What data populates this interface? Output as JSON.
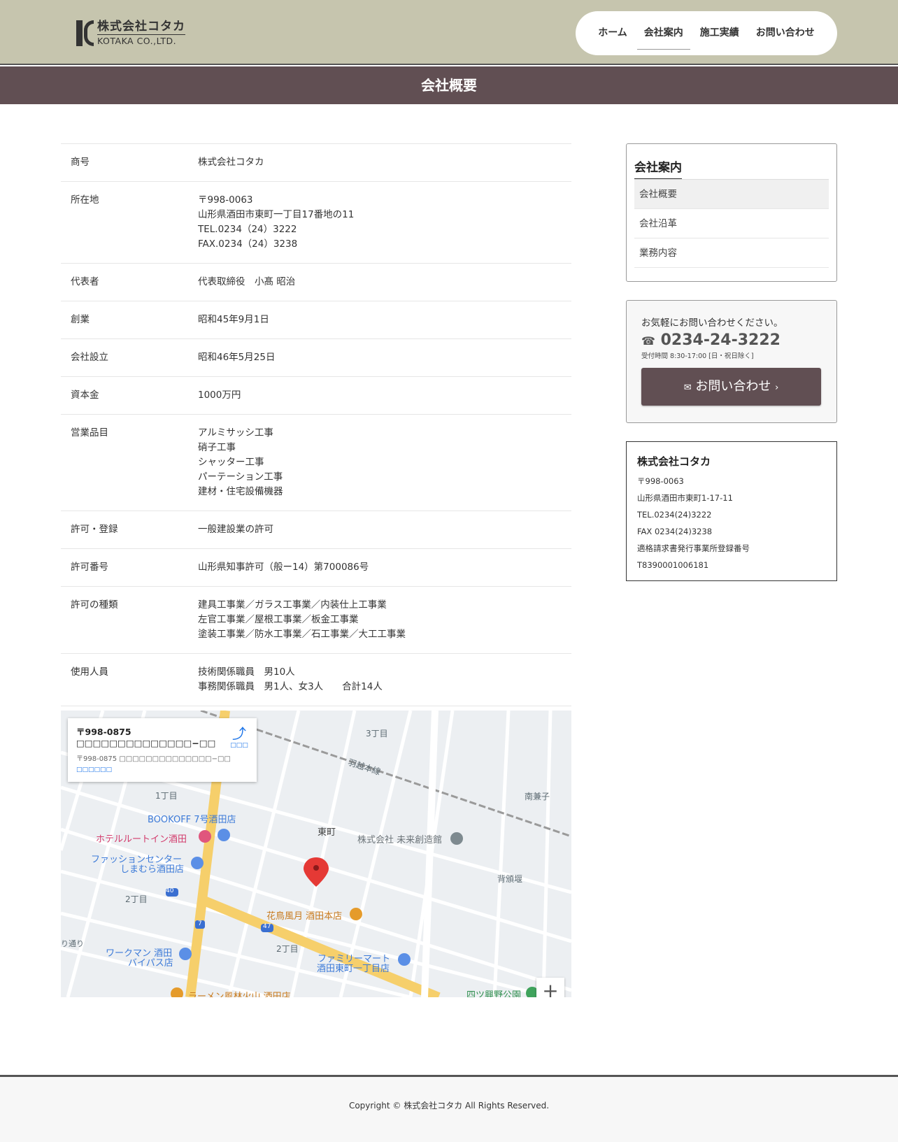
{
  "header": {
    "logo_jp": "株式会社コタカ",
    "logo_en": "KOTAKA CO.,LTD.",
    "nav": [
      "ホーム",
      "会社案内",
      "施工実績",
      "お問い合わせ"
    ]
  },
  "page_title": "会社概要",
  "info": [
    {
      "label": "商号",
      "lines": [
        "株式会社コタカ"
      ]
    },
    {
      "label": "所在地",
      "lines": [
        "〒998-0063",
        "山形県酒田市東町一丁目17番地の11",
        "TEL.0234（24）3222",
        "FAX.0234（24）3238"
      ]
    },
    {
      "label": "代表者",
      "lines": [
        "代表取締役　小髙 昭治"
      ]
    },
    {
      "label": "創業",
      "lines": [
        "昭和45年9月1日"
      ]
    },
    {
      "label": "会社設立",
      "lines": [
        "昭和46年5月25日"
      ]
    },
    {
      "label": "資本金",
      "lines": [
        "1000万円"
      ]
    },
    {
      "label": "営業品目",
      "lines": [
        "アルミサッシ工事",
        "硝子工事",
        "シャッター工事",
        "パーテーション工事",
        "建材・住宅設備機器"
      ]
    },
    {
      "label": "許可・登録",
      "lines": [
        "一般建設業の許可"
      ]
    },
    {
      "label": "許可番号",
      "lines": [
        "山形県知事許可（般ー14）第700086号"
      ]
    },
    {
      "label": "許可の種類",
      "lines": [
        "建具工事業／ガラス工事業／内装仕上工事業",
        "左官工事業／屋根工事業／板金工事業",
        "塗装工事業／防水工事業／石工事業／大工工事業"
      ]
    },
    {
      "label": "使用人員",
      "lines": [
        "技術関係職員　男10人",
        "事務関係職員　男1人、女3人　　合計14人"
      ]
    }
  ],
  "map": {
    "card_title": "〒998-0875 □□□□□□□□□□□□□□−□□",
    "card_addr": "〒998-0875 □□□□□□□□□□□□□□−□□",
    "card_link": "□□□□□□",
    "dir_label": "□□□",
    "labels": [
      "3丁目",
      "羽越本線",
      "南兼子",
      "1丁目",
      "BOOKOFF 7号酒田店",
      "ホテルルートイン酒田",
      "東町",
      "株式会社 未来創造館",
      "ファッションセンター",
      "しまむら酒田店",
      "背頒堰",
      "2丁目",
      "花鳥風月 酒田本店",
      "2丁目",
      "ワークマン 酒田",
      "バイパス店",
      "ファミリーマート",
      "酒田東町一丁目店",
      "四ツ興野公園",
      "ラーメン風林火山 酒田店",
      "り通り"
    ],
    "road_nums": [
      "40",
      "7",
      "47"
    ],
    "zoom_label": "+"
  },
  "sidebar": {
    "menu_title": "会社案内",
    "menu_items": [
      "会社概要",
      "会社沿革",
      "業務内容"
    ],
    "contact_lead": "お気軽にお問い合わせください。",
    "contact_tel": "0234-24-3222",
    "contact_hours": "受付時間 8:30-17:00 [日・祝日除く]",
    "contact_button": "お問い合わせ",
    "company_name": "株式会社コタカ",
    "company_lines": [
      "〒998-0063",
      "山形県酒田市東町1-17-11",
      "TEL.0234(24)3222",
      "FAX 0234(24)3238",
      "適格請求書発行事業所登録番号",
      "T8390001006181"
    ]
  },
  "footer": "Copyright © 株式会社コタカ All Rights Reserved.",
  "colors": {
    "header_bg": "#c6c5ae",
    "accent": "#614f53"
  }
}
